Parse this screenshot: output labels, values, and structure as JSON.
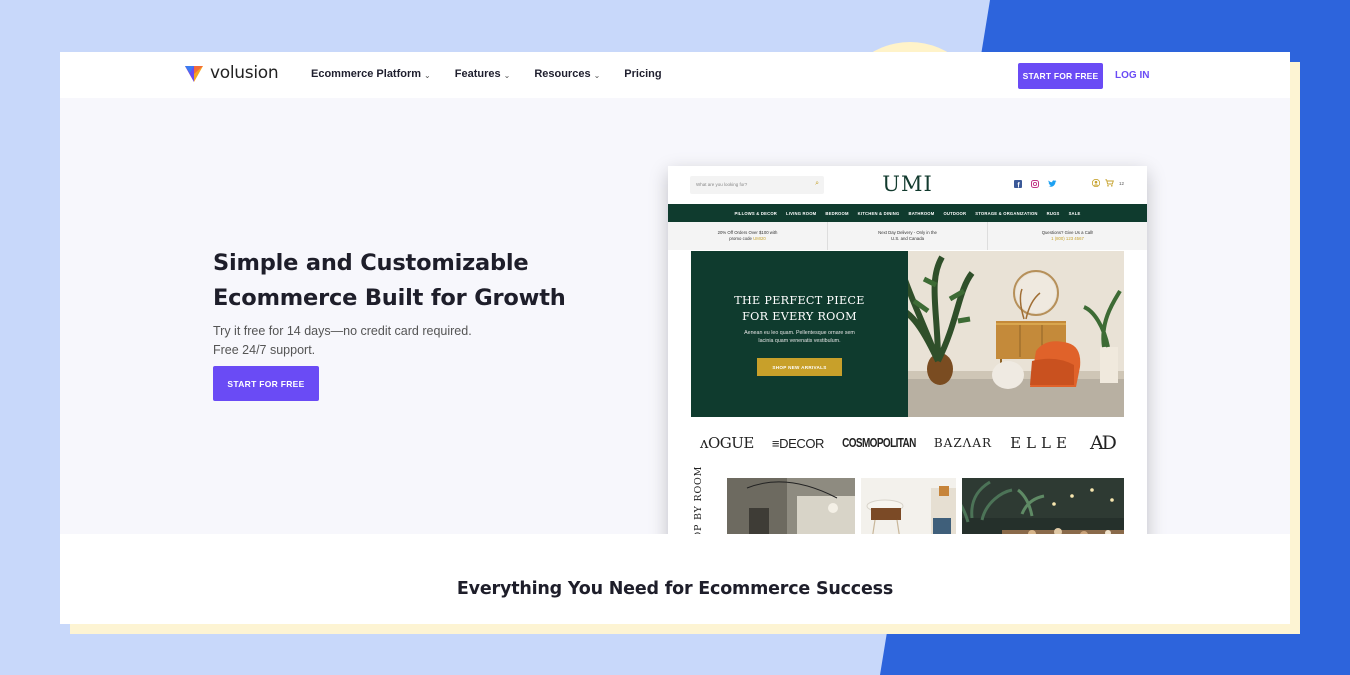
{
  "brand": {
    "name": "volusion",
    "accent_color": "#6a4bf5"
  },
  "nav": {
    "items": [
      {
        "label": "Ecommerce Platform",
        "has_dropdown": true
      },
      {
        "label": "Features",
        "has_dropdown": true
      },
      {
        "label": "Resources",
        "has_dropdown": true
      },
      {
        "label": "Pricing",
        "has_dropdown": false
      }
    ],
    "start_button": "START FOR FREE",
    "login": "LOG IN"
  },
  "hero": {
    "title_line1": "Simple and Customizable",
    "title_line2": "Ecommerce Built for Growth",
    "subtitle_line1": "Try it free for 14 days—no credit card required.",
    "subtitle_line2": "Free 24/7 support.",
    "cta": "START FOR FREE"
  },
  "store_preview": {
    "search_placeholder": "What are you looking for?",
    "logo": "UMI",
    "social_icons": [
      "facebook-icon",
      "instagram-icon",
      "twitter-icon"
    ],
    "cart_count": "12",
    "categories": [
      "PILLOWS & DECOR",
      "LIVING ROOM",
      "BEDROOM",
      "KITCHEN & DINING",
      "BATHROOM",
      "OUTDOOR",
      "STORAGE & ORGANIZATION",
      "RUGS",
      "SALE"
    ],
    "info_bar": [
      {
        "line1": "20% Off Orders Over $100 with",
        "line2": "promo code ",
        "highlight": "UMI20"
      },
      {
        "line1": "Next Day Delivery - Only in the",
        "line2": "U.S. and Canada",
        "highlight": ""
      },
      {
        "line1": "Questions? Give Us a Call!",
        "line2": "",
        "highlight": "1 (800) 123 4567"
      }
    ],
    "banner": {
      "title_line1": "THE PERFECT PIECE",
      "title_line2": "FOR EVERY ROOM",
      "text_line1": "Aenean eu leo quam. Pellentesque ornare sem",
      "text_line2": "lacinia quam venenatis vestibulum.",
      "button": "SHOP NEW ARRIVALS"
    },
    "press_logos": [
      "VOGUE",
      "ELLE DECOR",
      "COSMOPOLITAN",
      "BAZAAR",
      "ELLE",
      "AD"
    ],
    "press_display": [
      "ʌOGUE",
      "≡DECOR",
      "COSMOPOLITAN",
      "BAZΛAR",
      "ELLE",
      "AD"
    ],
    "shop_by_room_label": "SHOP BY ROOM"
  },
  "section": {
    "title": "Everything You Need for Ecommerce Success"
  }
}
